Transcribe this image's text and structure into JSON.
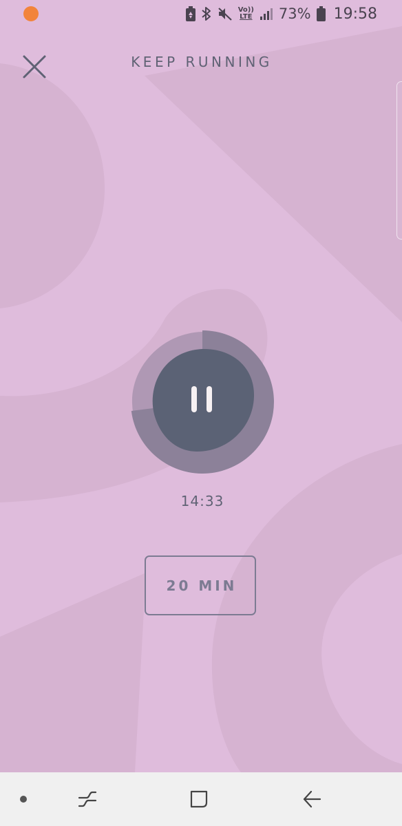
{
  "status_bar": {
    "battery_percent": "73%",
    "time": "19:58",
    "volte_top": "Vo))",
    "volte_bottom": "LTE",
    "icons": [
      "notification-dot",
      "battery-saver-icon",
      "bluetooth-icon",
      "mute-icon",
      "volte-icon",
      "signal-icon",
      "battery-icon"
    ],
    "notification_color": "#f2843b"
  },
  "header": {
    "title": "KEEP RUNNING",
    "close_icon": "close-icon"
  },
  "player": {
    "state": "playing",
    "control_icon": "pause-icon",
    "elapsed_time": "14:33",
    "progress_fraction": 0.73
  },
  "duration_button": {
    "label": "20 MIN"
  },
  "nav_bar": {
    "items": [
      "dot-icon",
      "recents-icon",
      "home-icon",
      "back-icon"
    ]
  },
  "colors": {
    "background": "#dfbcdc",
    "shape": "#d5b1d0",
    "accent_dark": "#5b6275",
    "text": "#5f6274"
  }
}
